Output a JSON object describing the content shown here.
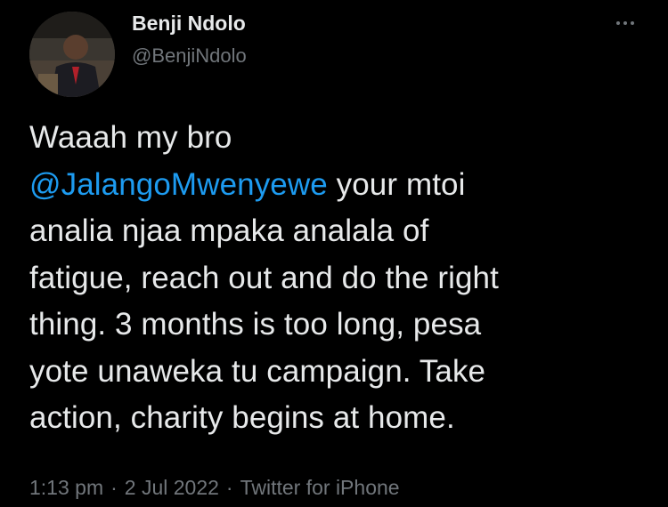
{
  "author": {
    "display_name": "Benji Ndolo",
    "handle": "@BenjiNdolo",
    "avatar_icon": "profile-photo"
  },
  "tweet": {
    "lines": [
      {
        "text": "Waaah my bro"
      },
      {
        "mention": "@JalangoMwenyewe",
        "text": " your mtoi"
      },
      {
        "text": "analia njaa mpaka analala of"
      },
      {
        "text": "fatigue, reach out and do the right"
      },
      {
        "text": "thing. 3 months is too long, pesa"
      },
      {
        "text": "yote unaweka tu campaign. Take"
      },
      {
        "text": "action, charity begins at home."
      }
    ]
  },
  "meta": {
    "time": "1:13 pm",
    "date": "2 Jul 2022",
    "source": "Twitter for iPhone",
    "separator": "·"
  },
  "colors": {
    "background": "#000000",
    "text": "#e7e9ea",
    "secondary": "#71767b",
    "mention": "#1d9bf0"
  },
  "icons": {
    "more": "more-horizontal-icon"
  }
}
